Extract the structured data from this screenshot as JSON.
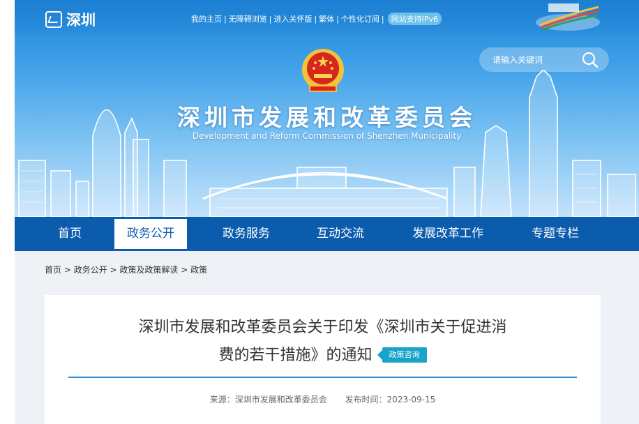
{
  "site": {
    "logo_text": "深圳",
    "title_cn": "深圳市发展和改革委员会",
    "title_en": "Development and Reform Commission of Shenzhen Municipality"
  },
  "toplinks": [
    "我的主页",
    "无障碍浏览",
    "进入关怀版",
    "繁体",
    "个性化订阅"
  ],
  "ipv6_badge": "网站支持IPv6",
  "search": {
    "placeholder": "请输入关键词"
  },
  "nav": [
    {
      "label": "首页"
    },
    {
      "label": "政务公开",
      "active": true
    },
    {
      "label": "政务服务"
    },
    {
      "label": "互动交流"
    },
    {
      "label": "发展改革工作"
    },
    {
      "label": "专题专栏"
    }
  ],
  "breadcrumb": [
    "首页",
    "政务公开",
    "政策及政策解读",
    "政策"
  ],
  "article": {
    "title_line1": "深圳市发展和改革委员会关于印发《深圳市关于促进消",
    "title_line2": "费的若干措施》的通知",
    "tag": "政策咨询",
    "source_label": "来源：深圳市发展和改革委员会",
    "date_label": "发布时间：2023-09-15"
  },
  "colors": {
    "nav_bg": "#0c5cad",
    "accent": "#2c8ad0",
    "tag": "#19a3c9"
  }
}
